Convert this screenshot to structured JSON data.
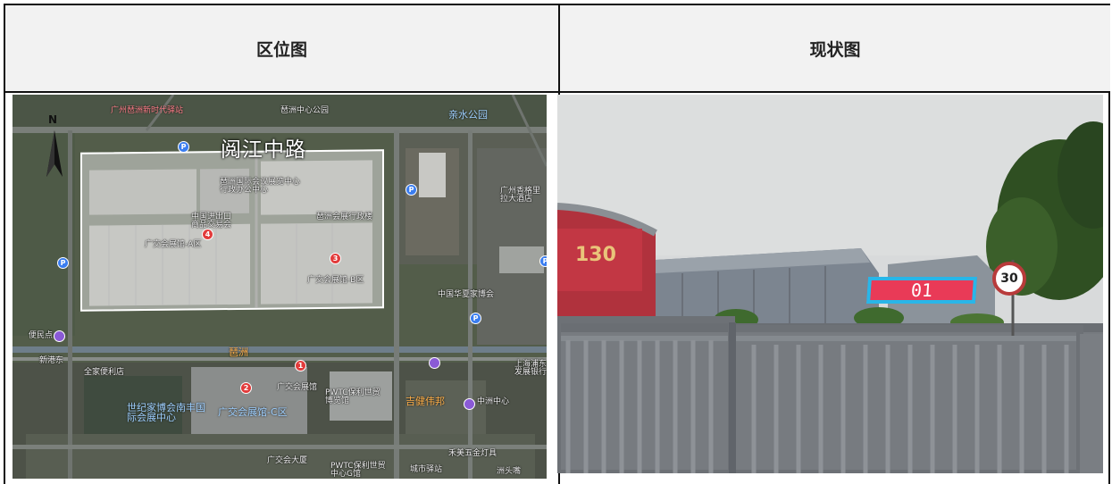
{
  "headers": {
    "left": "区位图",
    "right": "现状图"
  },
  "map": {
    "road_label": "阅江中路",
    "north_letter": "N",
    "labels": {
      "xinshidai": "广州琶洲新时代驿站",
      "zhongxin": "琶洲中心公园",
      "qinshui": "亲水公园",
      "huizhan": "琶洲国际会议展览中心行政办公中心",
      "jinchukou": "中国进出口商品交易会",
      "a_hall": "广交会展馆-A区",
      "hangzheng": "琶洲会展行政楼",
      "b_hall": "广交会展馆-B区",
      "hotel": "广州香格里拉大酒店",
      "huaxia": "中国华夏家博会",
      "bianmin": "便民点",
      "xingang": "新港东",
      "pazhou": "琶洲",
      "jiafa": "全家便利店",
      "shiji": "世纪家博会南丰国际会展中心",
      "c_hall": "广交会展馆-C区",
      "exhibit": "广交会展馆",
      "pwtc": "PWTC保利世贸博览馆",
      "jijian": "吉健伟邦",
      "zhongzhou": "中洲中心",
      "shanghai": "上海浦东发展银行",
      "daojiao": "广交会大厦",
      "pwtc2": "PWTC保利世贸中心G馆",
      "chengshi": "城市驿站",
      "yongfu": "禾美五金灯具",
      "zhaohang": "洲头嘴"
    },
    "pins": [
      "1",
      "2",
      "3",
      "4"
    ]
  },
  "photo": {
    "plate_text": "01",
    "speed_limit": "30",
    "banner_text": "130"
  },
  "colors": {
    "header_bg": "#f2f2f2",
    "plate_bg": "#e93a57",
    "plate_border": "#29b6e8",
    "site_outline": "#ffffff"
  }
}
